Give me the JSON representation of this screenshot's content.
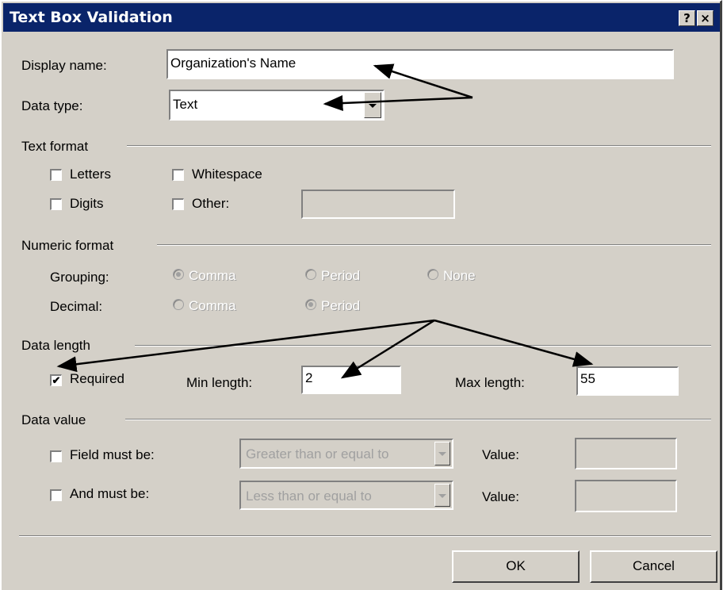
{
  "window": {
    "title": "Text Box Validation",
    "help_button": "?",
    "close_button": "×"
  },
  "display_name": {
    "label": "Display name:",
    "value": "Organization's Name"
  },
  "data_type": {
    "label": "Data type:",
    "value": "Text"
  },
  "text_format": {
    "heading": "Text format",
    "letters": "Letters",
    "whitespace": "Whitespace",
    "digits": "Digits",
    "other": "Other:"
  },
  "numeric_format": {
    "heading": "Numeric format",
    "grouping_label": "Grouping:",
    "grouping_comma": "Comma",
    "grouping_period": "Period",
    "grouping_none": "None",
    "decimal_label": "Decimal:",
    "decimal_comma": "Comma",
    "decimal_period": "Period"
  },
  "data_length": {
    "heading": "Data length",
    "required_label": "Required",
    "required_checked": true,
    "min_label": "Min length:",
    "min_value": "2",
    "max_label": "Max length:",
    "max_value": "55"
  },
  "data_value": {
    "heading": "Data value",
    "field_must_be_label": "Field must be:",
    "field_must_be_select": "Greater than or equal to",
    "and_must_be_label": "And must be:",
    "and_must_be_select": "Less than or equal to",
    "value_label_1": "Value:",
    "value_label_2": "Value:"
  },
  "buttons": {
    "ok": "OK",
    "cancel": "Cancel"
  },
  "colors": {
    "titlebar": "#0a246a",
    "face": "#d4d0c8",
    "disabled_text": "#a0a0a0"
  }
}
